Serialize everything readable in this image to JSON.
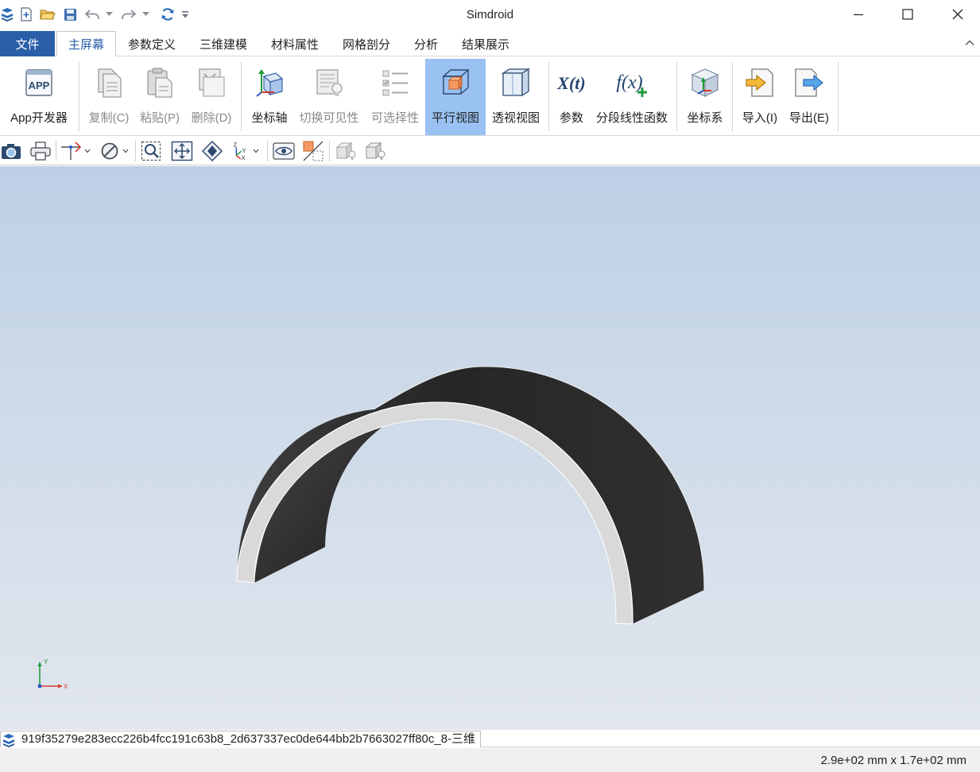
{
  "window": {
    "title": "Simdroid"
  },
  "menu": {
    "file_label": "文件",
    "tabs": [
      "主屏幕",
      "参数定义",
      "三维建模",
      "材料属性",
      "网格剖分",
      "分析",
      "结果展示"
    ],
    "active_tab": "主屏幕"
  },
  "ribbon": {
    "buttons": [
      {
        "label": "App开发器",
        "icon": "app-icon",
        "enabled": true
      },
      {
        "label": "复制(C)",
        "icon": "copy-icon",
        "enabled": false
      },
      {
        "label": "粘贴(P)",
        "icon": "paste-icon",
        "enabled": false
      },
      {
        "label": "删除(D)",
        "icon": "delete-icon",
        "enabled": false
      },
      {
        "label": "坐标轴",
        "icon": "axis-icon",
        "enabled": true
      },
      {
        "label": "切换可见性",
        "icon": "visibility-icon",
        "enabled": false
      },
      {
        "label": "可选择性",
        "icon": "selectability-icon",
        "enabled": false
      },
      {
        "label": "平行视图",
        "icon": "parallel-view-icon",
        "enabled": true,
        "selected": true
      },
      {
        "label": "透视视图",
        "icon": "perspective-view-icon",
        "enabled": true
      },
      {
        "label": "参数",
        "icon": "parameter-icon",
        "enabled": true
      },
      {
        "label": "分段线性函数",
        "icon": "piecewise-function-icon",
        "enabled": true
      },
      {
        "label": "坐标系",
        "icon": "coordinate-system-icon",
        "enabled": true
      },
      {
        "label": "导入(I)",
        "icon": "import-icon",
        "enabled": true
      },
      {
        "label": "导出(E)",
        "icon": "export-icon",
        "enabled": true
      }
    ]
  },
  "triad": {
    "x_label": "X",
    "y_label": "Y"
  },
  "document": {
    "tab_title": "919f35279e283ecc226b4fcc191c63b8_2d637337ec0de644bb2b7663027ff80c_8-三维"
  },
  "status": {
    "dimensions": "2.9e+02 mm x 1.7e+02 mm"
  },
  "colors": {
    "file_menu": "#2a5fa8",
    "selected_button": "#99c2f2",
    "viewport_top": "#bdd0e6",
    "viewport_bottom": "#e1e6ee",
    "model_dark": "#2b2b2b",
    "model_face": "#d9d9d9"
  }
}
